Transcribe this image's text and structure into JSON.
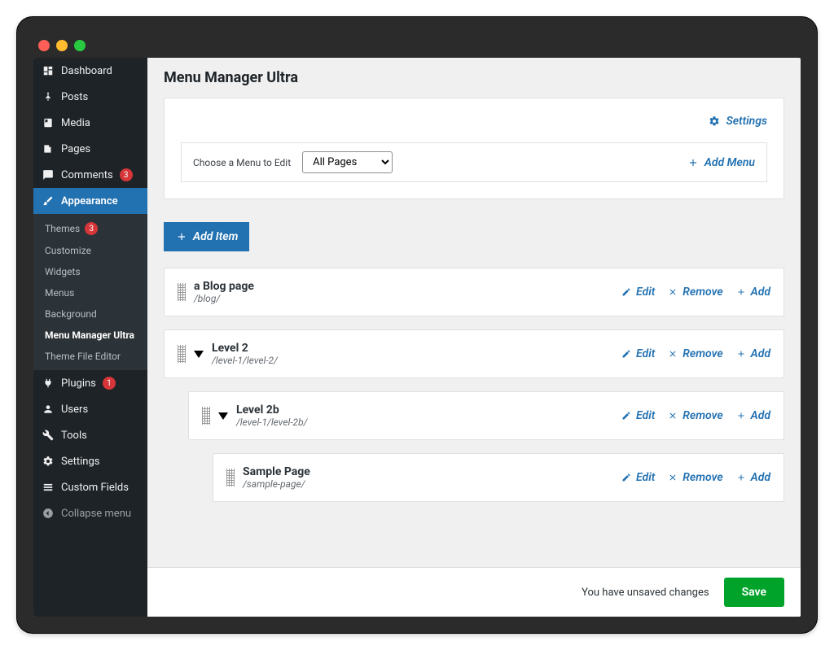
{
  "header": {
    "title": "Menu Manager Ultra"
  },
  "sidebar": {
    "items": [
      {
        "label": "Dashboard",
        "icon": "dash"
      },
      {
        "label": "Posts",
        "icon": "pin"
      },
      {
        "label": "Media",
        "icon": "media"
      },
      {
        "label": "Pages",
        "icon": "pages"
      },
      {
        "label": "Comments",
        "icon": "comment",
        "badge": "3"
      },
      {
        "label": "Appearance",
        "icon": "brush",
        "active": true
      },
      {
        "label": "Plugins",
        "icon": "plug",
        "badge": "1"
      },
      {
        "label": "Users",
        "icon": "user"
      },
      {
        "label": "Tools",
        "icon": "tools"
      },
      {
        "label": "Settings",
        "icon": "settings"
      },
      {
        "label": "Custom Fields",
        "icon": "fields"
      },
      {
        "label": "Collapse menu",
        "icon": "collapse",
        "muted": true
      }
    ],
    "submenu": [
      {
        "label": "Themes",
        "badge": "3"
      },
      {
        "label": "Customize"
      },
      {
        "label": "Widgets"
      },
      {
        "label": "Menus"
      },
      {
        "label": "Background"
      },
      {
        "label": "Menu Manager Ultra",
        "active": true
      },
      {
        "label": "Theme File Editor"
      }
    ]
  },
  "toolbar": {
    "settings_label": "Settings",
    "choose_label": "Choose a Menu to Edit",
    "select_value": "All Pages",
    "add_menu_label": "Add Menu",
    "add_item_label": "Add Item"
  },
  "actions": {
    "edit": "Edit",
    "remove": "Remove",
    "add": "Add"
  },
  "menu_items": [
    {
      "title": "a Blog page",
      "path": "/blog/",
      "indent": 0,
      "chevron": false
    },
    {
      "title": "Level 2",
      "path": "/level-1/level-2/",
      "indent": 0,
      "chevron": true
    },
    {
      "title": "Level 2b",
      "path": "/level-1/level-2b/",
      "indent": 1,
      "chevron": true
    },
    {
      "title": "Sample Page",
      "path": "/sample-page/",
      "indent": 2,
      "chevron": false
    }
  ],
  "footer": {
    "message": "You have unsaved changes",
    "save_label": "Save"
  }
}
